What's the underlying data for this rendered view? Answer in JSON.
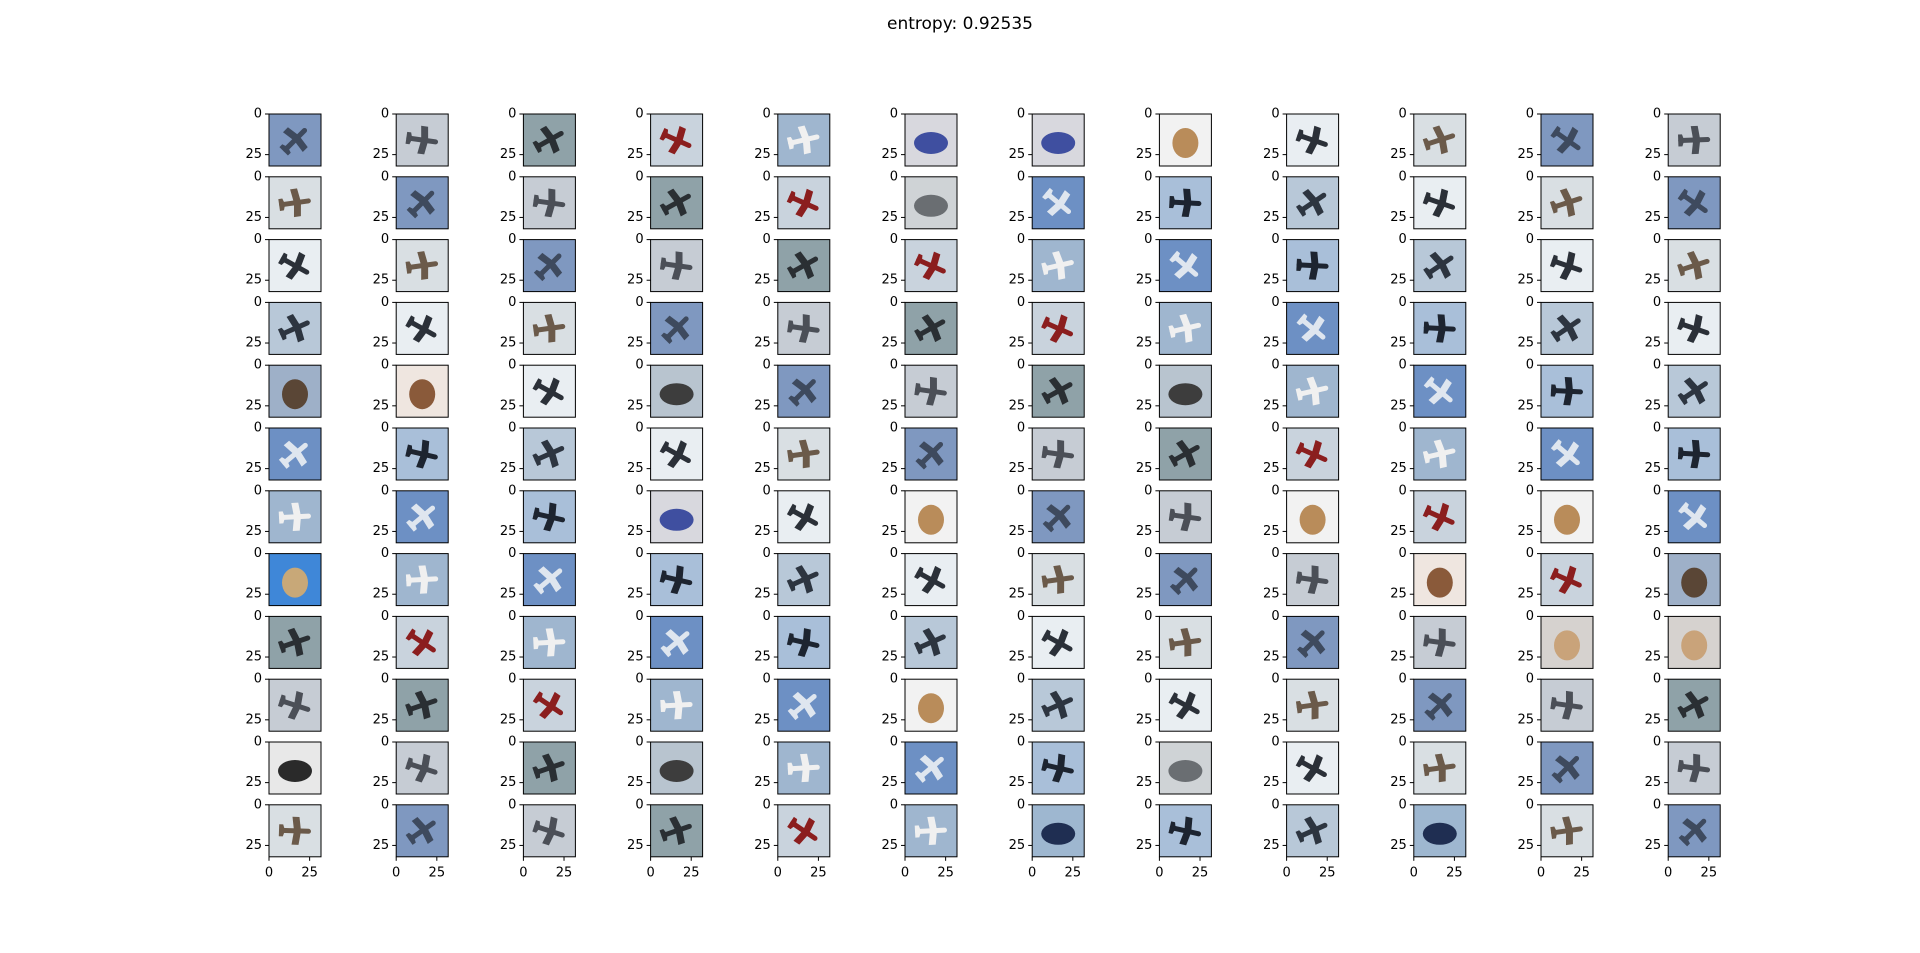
{
  "figure": {
    "title_prefix": "entropy: ",
    "title_value": "0.92535"
  },
  "chart_data": {
    "type": "image-grid",
    "title": "entropy: 0.92535",
    "rows": 12,
    "cols": 12,
    "x_ticks": [
      "0",
      "25"
    ],
    "y_ticks": [
      "0",
      "25"
    ],
    "xlim": [
      0,
      32
    ],
    "ylim": [
      32,
      0
    ],
    "images": [
      [
        "airplane",
        "airplane",
        "airplane",
        "airplane",
        "airplane",
        "truck",
        "truck",
        "dog",
        "airplane",
        "airplane",
        "airplane",
        "airplane"
      ],
      [
        "airplane",
        "airplane",
        "airplane",
        "airplane",
        "airplane",
        "building",
        "airplane",
        "airplane",
        "airplane",
        "airplane",
        "airplane",
        "airplane"
      ],
      [
        "airplane",
        "airplane",
        "airplane",
        "airplane",
        "airplane",
        "airplane",
        "airplane",
        "airplane",
        "airplane",
        "airplane",
        "airplane",
        "airplane"
      ],
      [
        "airplane",
        "airplane",
        "airplane",
        "airplane",
        "airplane",
        "airplane",
        "airplane",
        "airplane",
        "airplane",
        "airplane",
        "airplane",
        "airplane"
      ],
      [
        "cat",
        "dog",
        "airplane",
        "truck",
        "airplane",
        "airplane",
        "airplane",
        "truck",
        "airplane",
        "airplane",
        "airplane",
        "airplane"
      ],
      [
        "airplane",
        "airplane",
        "airplane",
        "airplane",
        "airplane",
        "airplane",
        "airplane",
        "airplane",
        "airplane",
        "airplane",
        "airplane",
        "airplane"
      ],
      [
        "airplane",
        "airplane",
        "airplane",
        "truck",
        "airplane",
        "dog",
        "airplane",
        "airplane",
        "dog",
        "airplane",
        "dog",
        "airplane"
      ],
      [
        "bird",
        "airplane",
        "airplane",
        "airplane",
        "airplane",
        "airplane",
        "airplane",
        "airplane",
        "airplane",
        "dog",
        "airplane",
        "cat"
      ],
      [
        "airplane",
        "airplane",
        "airplane",
        "airplane",
        "airplane",
        "airplane",
        "airplane",
        "airplane",
        "airplane",
        "airplane",
        "dog",
        "dog"
      ],
      [
        "airplane",
        "airplane",
        "airplane",
        "airplane",
        "airplane",
        "dog",
        "airplane",
        "airplane",
        "airplane",
        "airplane",
        "airplane",
        "airplane"
      ],
      [
        "car",
        "airplane",
        "airplane",
        "truck",
        "airplane",
        "airplane",
        "airplane",
        "building",
        "airplane",
        "airplane",
        "airplane",
        "airplane"
      ],
      [
        "airplane",
        "airplane",
        "airplane",
        "airplane",
        "airplane",
        "airplane",
        "truck",
        "airplane",
        "airplane",
        "truck",
        "airplane",
        "airplane"
      ]
    ]
  }
}
